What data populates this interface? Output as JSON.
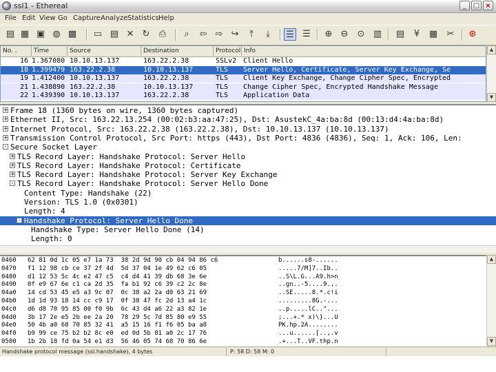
{
  "window": {
    "title": "ssl1 - Ethereal"
  },
  "menu": [
    "File",
    "Edit",
    "View",
    "Go",
    "Capture",
    "Analyze",
    "Statistics",
    "Help"
  ],
  "toolbar_icons": [
    "open-capture-icon",
    "save-icon",
    "options-icon",
    "start-capture-icon",
    "stop-icon",
    "open-file-icon",
    "save-as-icon",
    "close-icon",
    "reload-icon",
    "print-icon",
    "find-icon",
    "back-icon",
    "forward-icon",
    "go-to-icon",
    "first-packet-icon",
    "last-packet-icon",
    "colorize-icon",
    "auto-scroll-icon",
    "zoom-in-icon",
    "zoom-out-icon",
    "zoom-normal-icon",
    "resize-columns-icon",
    "capture-filters-icon",
    "display-filters-icon",
    "coloring-rules-icon",
    "preferences-icon",
    "help-icon"
  ],
  "packet_list": {
    "columns": [
      "No. .",
      "Time",
      "Source",
      "Destination",
      "Protocol",
      "Info"
    ],
    "rows": [
      {
        "no": "16",
        "time": "1.367080",
        "src": "10.10.13.137",
        "dst": "163.22.2.38",
        "proto": "SSLv2",
        "info": "Client Hello",
        "bg": "#ffffff",
        "fg": "#000000",
        "selected": false
      },
      {
        "no": "18",
        "time": "1.399479",
        "src": "163.22.2.38",
        "dst": "10.10.13.137",
        "proto": "TLS",
        "info": "Server Hello, Certificate, Server Key Exchange, Se",
        "bg": "#316ac5",
        "fg": "#ffffff",
        "selected": true
      },
      {
        "no": "19",
        "time": "1.412400",
        "src": "10.10.13.137",
        "dst": "163.22.2.38",
        "proto": "TLS",
        "info": "Client Key Exchange, Change Cipher Spec, Encrypted",
        "bg": "#e7e6ff",
        "fg": "#000000",
        "selected": false
      },
      {
        "no": "21",
        "time": "1.438890",
        "src": "163.22.2.38",
        "dst": "10.10.13.137",
        "proto": "TLS",
        "info": "Change Cipher Spec, Encrypted Handshake Message",
        "bg": "#e7e6ff",
        "fg": "#000000",
        "selected": false
      },
      {
        "no": "22",
        "time": "1.439390",
        "src": "10.10.13.137",
        "dst": "163.22.2.38",
        "proto": "TLS",
        "info": "Application Data",
        "bg": "#e7e6ff",
        "fg": "#000000",
        "selected": false
      }
    ]
  },
  "details": [
    {
      "indent": 0,
      "toggle": "+",
      "text": "Frame 18 (1360 bytes on wire, 1360 bytes captured)",
      "selected": false
    },
    {
      "indent": 0,
      "toggle": "+",
      "text": "Ethernet II, Src: 163.22.13.254 (00:02:b3:aa:47:25), Dst: AsustekC_4a:ba:8d (00:13:d4:4a:ba:8d)",
      "selected": false
    },
    {
      "indent": 0,
      "toggle": "+",
      "text": "Internet Protocol, Src: 163.22.2.38 (163.22.2.38), Dst: 10.10.13.137 (10.10.13.137)",
      "selected": false
    },
    {
      "indent": 0,
      "toggle": "+",
      "text": "Transmission Control Protocol, Src Port: https (443), Dst Port: 4836 (4836), Seq: 1, Ack: 106, Len:",
      "selected": false
    },
    {
      "indent": 0,
      "toggle": "-",
      "text": "Secure Socket Layer",
      "selected": false
    },
    {
      "indent": 1,
      "toggle": "+",
      "text": "TLS Record Layer: Handshake Protocol: Server Hello",
      "selected": false
    },
    {
      "indent": 1,
      "toggle": "+",
      "text": "TLS Record Layer: Handshake Protocol: Certificate",
      "selected": false
    },
    {
      "indent": 1,
      "toggle": "+",
      "text": "TLS Record Layer: Handshake Protocol: Server Key Exchange",
      "selected": false
    },
    {
      "indent": 1,
      "toggle": "-",
      "text": "TLS Record Layer: Handshake Protocol: Server Hello Done",
      "selected": false
    },
    {
      "indent": 2,
      "toggle": "",
      "text": "Content Type: Handshake (22)",
      "selected": false
    },
    {
      "indent": 2,
      "toggle": "",
      "text": "Version: TLS 1.0 (0x0301)",
      "selected": false
    },
    {
      "indent": 2,
      "toggle": "",
      "text": "Length: 4",
      "selected": false
    },
    {
      "indent": 2,
      "toggle": "-",
      "text": "Handshake Protocol: Server Hello Done",
      "selected": true
    },
    {
      "indent": 3,
      "toggle": "",
      "text": "Handshake Type: Server Hello Done (14)",
      "selected": false
    },
    {
      "indent": 3,
      "toggle": "",
      "text": "Length: 0",
      "selected": false
    }
  ],
  "bytes": [
    {
      "off": "0460",
      "hex": "62 81 0d 1c 05 e7 1a 73  38 2d 9d 90 cb 04 94 86 c6",
      "asc": "b......s8-......"
    },
    {
      "off": "0470",
      "hex": "f1 12 98 cb ce 37 2f 4d  5d 37 04 1e 49 62 c6 05",
      "asc": ".....7/M]7..Ib.."
    },
    {
      "off": "0480",
      "hex": "d1 12 53 5c 4c e2 47 c5  c4 d4 41 39 db 68 3e 6e",
      "asc": "..S\\L.G...A9.h>n"
    },
    {
      "off": "0490",
      "hex": "0f e9 67 6e c1 ca 2d 35  fa b1 92 c6 39 c2 2c 8e",
      "asc": "..gn..-5....9.,."
    },
    {
      "off": "04a0",
      "hex": "14 cd 53 45 e5 a3 9c 07  0c 38 a2 2a d0 63 21 69",
      "asc": "..SE.....8.*.c!i"
    },
    {
      "off": "04b0",
      "hex": "1d 1d 93 18 14 cc c9 17  0f 38 47 fc 2d 13 a4 1c",
      "asc": ".........8G.-..."
    },
    {
      "off": "04c0",
      "hex": "d6 d8 70 95 85 00 f0 9b  6c 43 d4 a6 22 a3 82 1e",
      "asc": "..p.....lC..\"..."
    },
    {
      "off": "04d0",
      "hex": "3b 17 2e e5 2b ee 2a 20  78 29 5c 7d 85 80 e9 55",
      "asc": ";...+.* x)\\}...U"
    },
    {
      "off": "04e0",
      "hex": "50 4b a0 68 70 85 32 41  a5 15 16 f1 f6 05 ba a8",
      "asc": "PK.hp.2A........"
    },
    {
      "off": "04f0",
      "hex": "b9 99 ce 75 b2 b2 8c e0  ed 0d 5b 81 a0 2c 17 76",
      "asc": "...u......[..,.v"
    },
    {
      "off": "0500",
      "hex": "1b 2b 18 fd 0a 54 e1 d3  56 46 05 74 68 70 86 6e",
      "asc": ".+...T..VF.thp.n"
    }
  ],
  "status": {
    "left": "Handshake protocol message (ssl.handshake), 4 bytes",
    "right": "P: 58 D: 58 M: 0"
  }
}
